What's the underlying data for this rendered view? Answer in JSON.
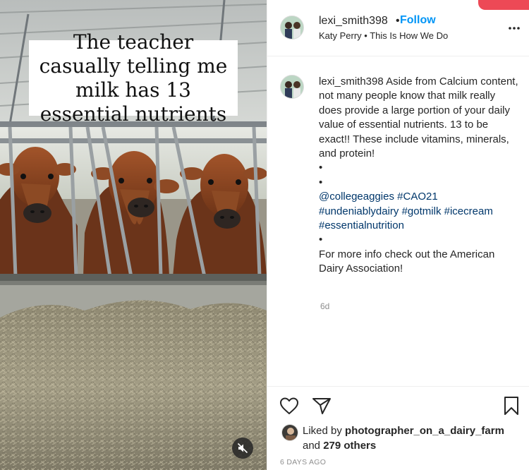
{
  "post": {
    "caption_overlay": "The teacher casually telling me milk has 13 essential nutrients",
    "username": "lexi_smith398",
    "dot": "•",
    "follow_label": "Follow",
    "audio_track": "Katy Perry • This Is How We Do",
    "comment": {
      "username": "lexi_smith398",
      "text": "Aside from Calcium content, not many people know that milk really does provide a large portion of your daily value of essential nutrients. 13 to be exact!! These include vitamins, minerals, and protein!",
      "bullet": "•",
      "tags": [
        "@collegeaggies",
        "#CAO21",
        "#undeniablydairy",
        "#gotmilk",
        "#icecream",
        "#essentialnutrition"
      ],
      "closing": "For more info check out the American Dairy Association!"
    },
    "comment_age": "6d",
    "liked_by_prefix": "Liked by",
    "liked_by_user": "photographer_on_a_dairy_farm",
    "and_label": "and",
    "others_count": "279 others",
    "timestamp": "6 DAYS AGO"
  },
  "icons": {
    "more": "more-options-icon",
    "like": "heart-icon",
    "share": "paper-plane-icon",
    "save": "bookmark-icon",
    "mute": "speaker-muted-icon"
  },
  "colors": {
    "follow": "#0095f6",
    "hashtag": "#00376b",
    "muted_text": "#8e8e8e",
    "notification": "#ed4956"
  }
}
